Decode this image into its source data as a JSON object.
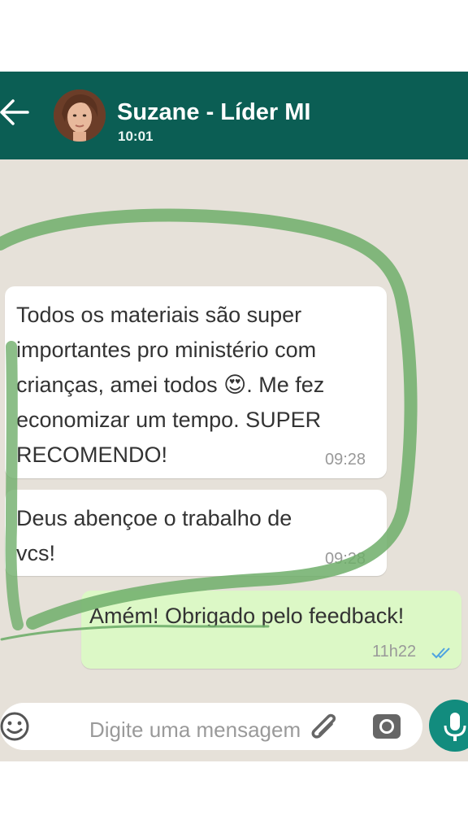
{
  "header": {
    "contact_name": "Suzane - Líder MI",
    "status": "10:01",
    "back_icon": "arrow-left-icon",
    "avatar_icon": "contact-avatar"
  },
  "messages": [
    {
      "direction": "incoming",
      "text": "Todos os materiais são super importantes pro ministério com crianças, amei todos 😍. Me fez economizar um tempo. SUPER RECOMENDO!",
      "lines": [
        "Todos os materiais são super",
        "importantes pro ministério com",
        "crianças, amei todos 😍. Me fez",
        "economizar um tempo. SUPER",
        "RECOMENDO!"
      ],
      "time": "09:28"
    },
    {
      "direction": "incoming",
      "text": "Deus abençoe o trabalho de vcs!",
      "lines": [
        "Deus abençoe o trabalho de",
        "vcs!"
      ],
      "time": "09:28"
    },
    {
      "direction": "outgoing",
      "text": "Amém! Obrigado pelo feedback!",
      "time": "11h22",
      "status_icon": "double-check-read-icon"
    }
  ],
  "input": {
    "placeholder": "Digite uma mensagem",
    "emoji_icon": "emoji-icon",
    "attach_icon": "paperclip-icon",
    "camera_icon": "camera-icon",
    "mic_icon": "microphone-icon"
  },
  "colors": {
    "header": "#0b5e54",
    "chat_background": "#e6e1d9",
    "incoming_bubble": "#ffffff",
    "outgoing_bubble": "#dcf8c6",
    "annotation_stroke": "#6fae6a",
    "read_ticks": "#4fa3e0",
    "mic_button": "#128c7e"
  }
}
